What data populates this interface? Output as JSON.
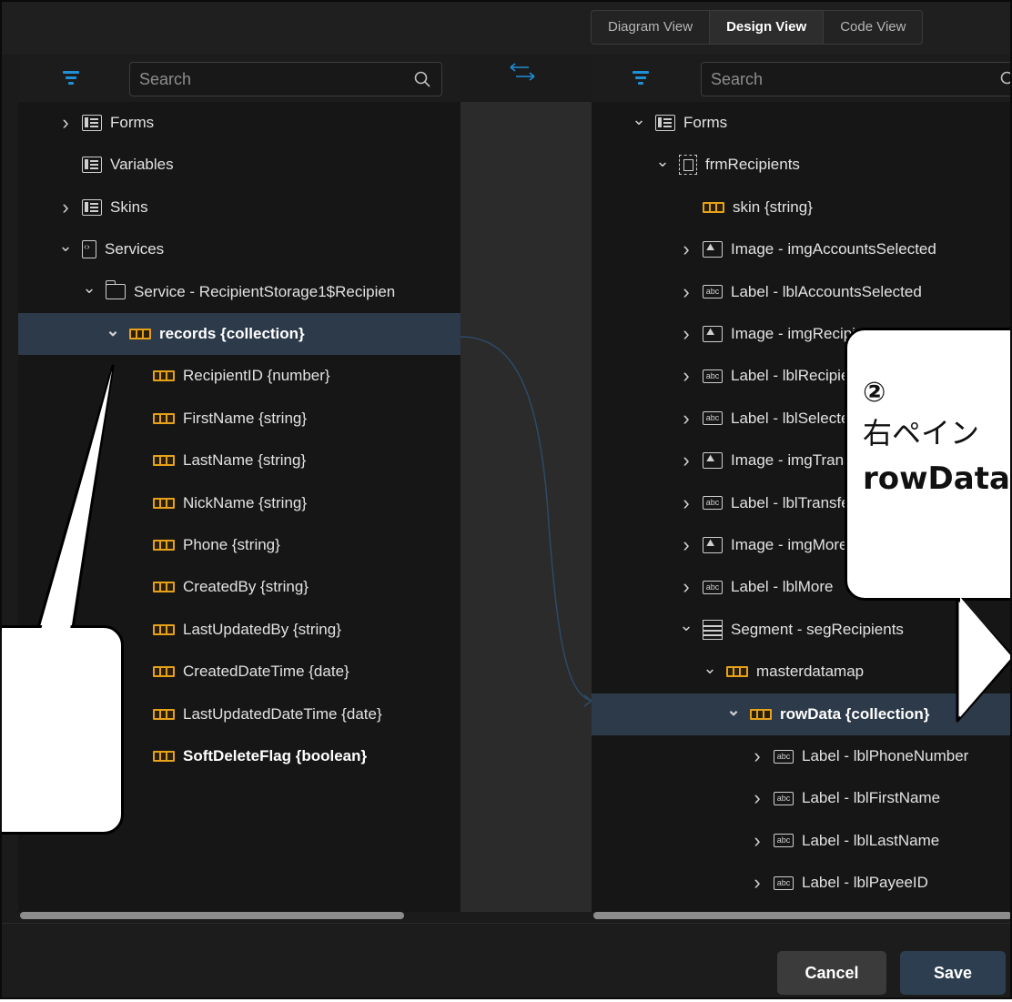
{
  "view_tabs": [
    {
      "label": "Diagram View",
      "active": false
    },
    {
      "label": "Design View",
      "active": true
    },
    {
      "label": "Code View",
      "active": false
    }
  ],
  "left_toolbar": {
    "search_placeholder": "Search"
  },
  "right_toolbar": {
    "search_placeholder": "Search"
  },
  "left_tree": [
    {
      "label": "Forms",
      "icon": "form-icon",
      "chevron": "right",
      "indent": 0
    },
    {
      "label": "Variables",
      "icon": "form-icon",
      "chevron": "none",
      "indent": 0
    },
    {
      "label": "Skins",
      "icon": "form-icon",
      "chevron": "right",
      "indent": 0
    },
    {
      "label": "Services",
      "icon": "file-code-icon",
      "chevron": "down",
      "indent": 0
    },
    {
      "label": "Service - RecipientStorage1$Recipien",
      "icon": "folder-icon",
      "chevron": "down",
      "indent": 1
    },
    {
      "label": "records {collection}",
      "icon": "collection-icon",
      "chevron": "down",
      "indent": 2,
      "selected": true,
      "bold": true
    },
    {
      "label": "RecipientID {number}",
      "icon": "collection-icon",
      "chevron": "none",
      "indent": 3
    },
    {
      "label": "FirstName {string}",
      "icon": "collection-icon",
      "chevron": "none",
      "indent": 3
    },
    {
      "label": "LastName {string}",
      "icon": "collection-icon",
      "chevron": "none",
      "indent": 3
    },
    {
      "label": "NickName {string}",
      "icon": "collection-icon",
      "chevron": "none",
      "indent": 3
    },
    {
      "label": "Phone {string}",
      "icon": "collection-icon",
      "chevron": "none",
      "indent": 3
    },
    {
      "label": "CreatedBy {string}",
      "icon": "collection-icon",
      "chevron": "none",
      "indent": 3
    },
    {
      "label": "LastUpdatedBy {string}",
      "icon": "collection-icon",
      "chevron": "none",
      "indent": 3
    },
    {
      "label": "CreatedDateTime {date}",
      "icon": "collection-icon",
      "chevron": "none",
      "indent": 3
    },
    {
      "label": "LastUpdatedDateTime {date}",
      "icon": "collection-icon",
      "chevron": "none",
      "indent": 3
    },
    {
      "label": "SoftDeleteFlag {boolean}",
      "icon": "collection-icon",
      "chevron": "none",
      "indent": 3,
      "bold": true
    }
  ],
  "right_tree": [
    {
      "label": "Forms",
      "icon": "form-icon",
      "chevron": "down",
      "indent": 0
    },
    {
      "label": "frmRecipients",
      "icon": "frame-icon",
      "chevron": "down",
      "indent": 1
    },
    {
      "label": "skin {string}",
      "icon": "collection-icon",
      "chevron": "none",
      "indent": 2
    },
    {
      "label": "Image - imgAccountsSelected",
      "icon": "image-icon",
      "chevron": "right",
      "indent": 2
    },
    {
      "label": "Label - lblAccountsSelected",
      "icon": "label-icon",
      "chevron": "right",
      "indent": 2
    },
    {
      "label": "Image - imgRecipients",
      "icon": "image-icon",
      "chevron": "right",
      "indent": 2
    },
    {
      "label": "Label - lblRecipients",
      "icon": "label-icon",
      "chevron": "right",
      "indent": 2
    },
    {
      "label": "Label - lblSelected",
      "icon": "label-icon",
      "chevron": "right",
      "indent": 2
    },
    {
      "label": "Image - imgTransfers",
      "icon": "image-icon",
      "chevron": "right",
      "indent": 2
    },
    {
      "label": "Label - lblTransfers",
      "icon": "label-icon",
      "chevron": "right",
      "indent": 2
    },
    {
      "label": "Image - imgMore",
      "icon": "image-icon",
      "chevron": "right",
      "indent": 2
    },
    {
      "label": "Label - lblMore",
      "icon": "label-icon",
      "chevron": "right",
      "indent": 2
    },
    {
      "label": "Segment - segRecipients",
      "icon": "segment-icon",
      "chevron": "down",
      "indent": 2
    },
    {
      "label": "masterdatamap",
      "icon": "collection-icon",
      "chevron": "down",
      "indent": 3
    },
    {
      "label": "rowData {collection}",
      "icon": "collection-icon",
      "chevron": "down",
      "indent": 4,
      "selected": true,
      "bold": true
    },
    {
      "label": "Label - lblPhoneNumber",
      "icon": "label-icon",
      "chevron": "right",
      "indent": 5
    },
    {
      "label": "Label - lblFirstName",
      "icon": "label-icon",
      "chevron": "right",
      "indent": 5
    },
    {
      "label": "Label - lblLastName",
      "icon": "label-icon",
      "chevron": "right",
      "indent": 5
    },
    {
      "label": "Label - lblPayeeID",
      "icon": "label-icon",
      "chevron": "right",
      "indent": 5
    }
  ],
  "footer": {
    "cancel_label": "Cancel",
    "save_label": "Save"
  },
  "callout_right": {
    "number": "②",
    "line1": "右ペイン",
    "line2": "rowData"
  },
  "colors": {
    "accent_blue": "#1f8fd6",
    "collection_icon": "#e6a11b",
    "selected_row": "#2c3a4a",
    "save_button": "#2c3e50"
  }
}
